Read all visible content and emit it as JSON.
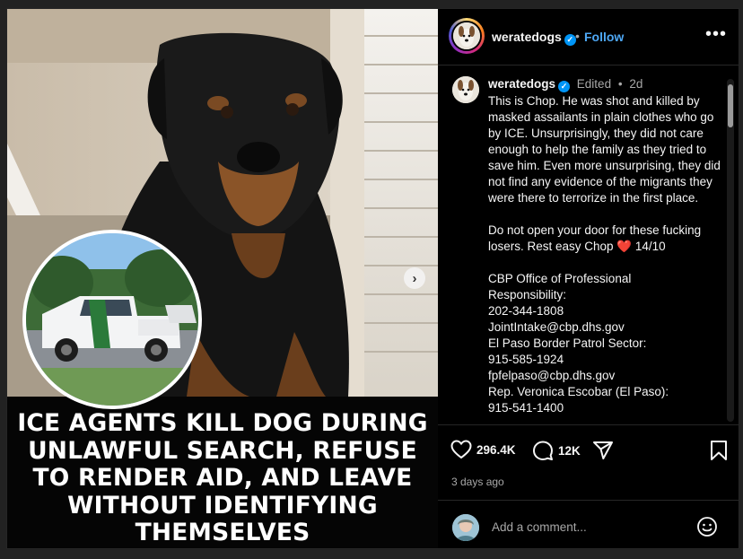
{
  "post": {
    "headline": "ICE AGENTS KILL DOG DURING UNLAWFUL SEARCH, REFUSE TO RENDER AID, AND LEAVE WITHOUT IDENTIFYING THEMSELVES",
    "next_icon": "chevron-right-icon"
  },
  "header": {
    "username": "weratedogs",
    "verified_icon": "verified-badge-icon",
    "separator": "•",
    "follow_label": "Follow",
    "more_label": "•••"
  },
  "caption": {
    "username": "weratedogs",
    "edited": "Edited",
    "dot": "•",
    "age": "2d",
    "p1": "This is Chop. He was shot and killed by masked assailants in plain clothes who go by ICE. Unsurprisingly, they did not care enough to help the family as they tried to save him. Even more unsurprising, they did not find any evidence of the migrants they were there to terrorize in the first place.",
    "p2_a": "Do not open your door for these fucking losers. Rest easy Chop ",
    "p2_heart": "❤️",
    "p2_b": " 14/10",
    "contacts": [
      "CBP Office of Professional",
      "Responsibility:",
      "202-344-1808",
      "JointIntake@cbp.dhs.gov",
      "El Paso Border Patrol Sector:",
      "915-585-1924",
      "fpfelpaso@cbp.dhs.gov",
      "Rep. Veronica Escobar (El Paso):",
      "915-541-1400"
    ]
  },
  "actions": {
    "likes": "296.4K",
    "comments": "12K",
    "time_ago": "3 days ago"
  },
  "comment": {
    "placeholder": "Add a comment..."
  },
  "colors": {
    "link_blue": "#4ea8f5",
    "verified_blue": "#0095f6",
    "heart_red": "#ed4956"
  }
}
